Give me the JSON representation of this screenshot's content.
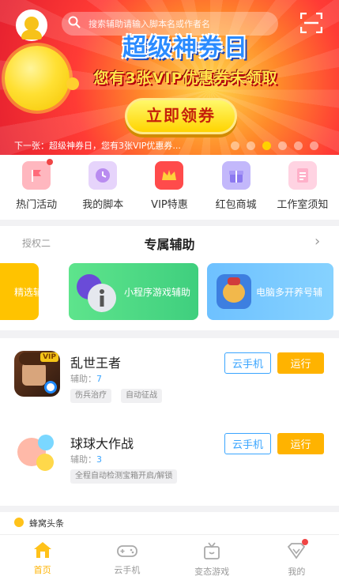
{
  "header": {
    "search_placeholder": "搜索辅助请输入脚本名或作者名"
  },
  "banner": {
    "title": "超级神券日",
    "subtitle": "您有3张VIP优惠券未领取",
    "cta_label": "立即领券",
    "caption": "下一张：超级神券日，您有3张VIP优惠券..."
  },
  "quick_nav": [
    {
      "label": "热门活动",
      "icon": "flag-icon",
      "color": "#ff6b7a"
    },
    {
      "label": "我的脚本",
      "icon": "clock-icon",
      "color": "#b98cf0"
    },
    {
      "label": "VIP特惠",
      "icon": "crown-icon",
      "color": "#ff4b4b"
    },
    {
      "label": "红包商城",
      "icon": "gift-icon",
      "color": "#9d8cf5"
    },
    {
      "label": "工作室须知",
      "icon": "document-icon",
      "color": "#ff7ea5"
    }
  ],
  "assist": {
    "tag": "授权二",
    "title": "专属辅助",
    "cards": [
      {
        "label": "精选辅助",
        "color": "#ffc300"
      },
      {
        "label": "小程序游戏辅助",
        "color": "#4fd885"
      },
      {
        "label": "电脑多开养号辅",
        "color": "#6fc3ff"
      }
    ]
  },
  "games": [
    {
      "name": "乱世王者",
      "assist_label": "辅助：",
      "assist_count": "7",
      "tags": [
        "伤兵治疗",
        "自动征战"
      ],
      "badge": "VIP",
      "cloud_label": "云手机",
      "run_label": "运行"
    },
    {
      "name": "球球大作战",
      "assist_label": "辅助：",
      "assist_count": "3",
      "tags": [
        "全程自动检测宝箱开启/解锁"
      ],
      "cloud_label": "云手机",
      "run_label": "运行"
    }
  ],
  "news": {
    "label": "蜂窝头条"
  },
  "tabs": [
    {
      "label": "首页",
      "active": true
    },
    {
      "label": "云手机",
      "active": false
    },
    {
      "label": "变态游戏",
      "active": false
    },
    {
      "label": "我的",
      "active": false
    }
  ],
  "colors": {
    "accent": "#ffb300",
    "link": "#3aa5ff",
    "badge": "#f04545"
  }
}
